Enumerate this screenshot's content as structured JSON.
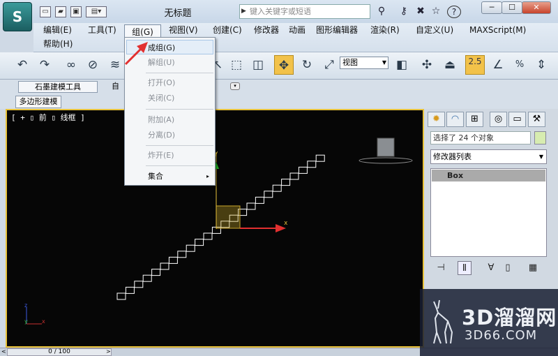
{
  "titlebar": {
    "title": "无标题",
    "search_placeholder": "键入关键字或短语",
    "help_label": "?",
    "min_label": "─",
    "max_label": "☐",
    "close_label": "✕"
  },
  "menubar": {
    "items": [
      "编辑(E)",
      "工具(T)",
      "组(G)",
      "视图(V)",
      "创建(C)",
      "修改器",
      "动画",
      "图形编辑器",
      "渲染(R)",
      "自定义(U)",
      "MAXScript(M)",
      "帮助(H)"
    ]
  },
  "toolbar": {
    "view_dropdown": "视图",
    "snap_value": "2.5",
    "percent_label": "%",
    "sel_colors": {
      "active": "#f2c24a"
    }
  },
  "ribbon": {
    "tab1": "石墨建模工具",
    "tab2": "自",
    "subtab": "多边形建模"
  },
  "viewport": {
    "label": "[ + ▯ 前 ▯ 线框 ]",
    "axis_x": "x",
    "axis_y": "y",
    "axis_z": "z"
  },
  "group_menu": {
    "items": [
      {
        "label": "成组(G)",
        "enabled": true
      },
      {
        "label": "解组(U)",
        "enabled": false
      },
      {
        "label": "打开(O)",
        "enabled": false
      },
      {
        "label": "关闭(C)",
        "enabled": false
      },
      {
        "label": "附加(A)",
        "enabled": false
      },
      {
        "label": "分离(D)",
        "enabled": false
      },
      {
        "label": "炸开(E)",
        "enabled": false
      },
      {
        "label": "集合",
        "enabled": true,
        "submenu": "▸"
      }
    ]
  },
  "command_panel": {
    "selection_text": "选择了 24 个对象",
    "modifier_list": "修改器列表",
    "stack_item": "Box"
  },
  "timeline": {
    "frame": "0 / 100",
    "prev": "<",
    "next": ">"
  },
  "watermark": {
    "brand": "3D溜溜网",
    "domain": "3D66.COM"
  },
  "colors": {
    "viewport_border": "#e8c23a",
    "step_outline": "#ffffff",
    "arrow_red": "#e23030"
  }
}
